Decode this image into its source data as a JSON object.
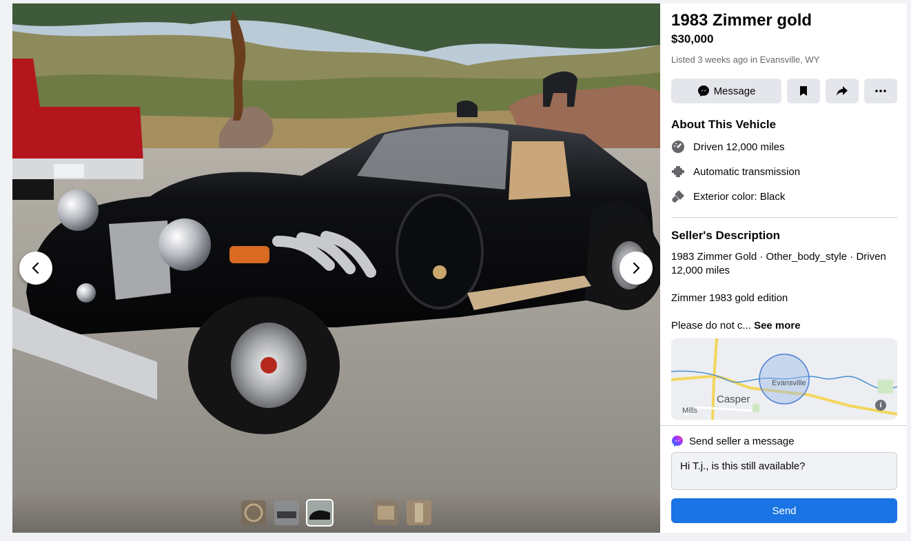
{
  "listing": {
    "title": "1983 Zimmer gold",
    "price": "$30,000",
    "listed_prefix": "Listed 3 weeks ago in ",
    "location": "Evansville, WY"
  },
  "actions": {
    "message_label": "Message",
    "save_icon": "bookmark-icon",
    "share_icon": "share-arrow-icon",
    "more_icon": "more-dots-icon"
  },
  "about": {
    "heading": "About This Vehicle",
    "specs": [
      {
        "icon": "speedometer-icon",
        "text": "Driven 12,000 miles"
      },
      {
        "icon": "transmission-icon",
        "text": "Automatic transmission"
      },
      {
        "icon": "paint-icon",
        "text": "Exterior color: Black"
      }
    ]
  },
  "description": {
    "heading": "Seller's Description",
    "line1": "1983 Zimmer Gold · Other_body_style · Driven 12,000 miles",
    "line2": "Zimmer 1983 gold edition",
    "line3": "Please do not c...",
    "see_more": "See more"
  },
  "map": {
    "labels": [
      "Casper",
      "Evansville",
      "Mills"
    ]
  },
  "messaging": {
    "heading": "Send seller a message",
    "message_value": "Hi T.j., is this still available?",
    "send_label": "Send"
  },
  "colors": {
    "primary": "#1b74e4",
    "button_bg": "#e4e6eb",
    "car_body": "#0c0d10",
    "pickup_red": "#b3161d"
  }
}
